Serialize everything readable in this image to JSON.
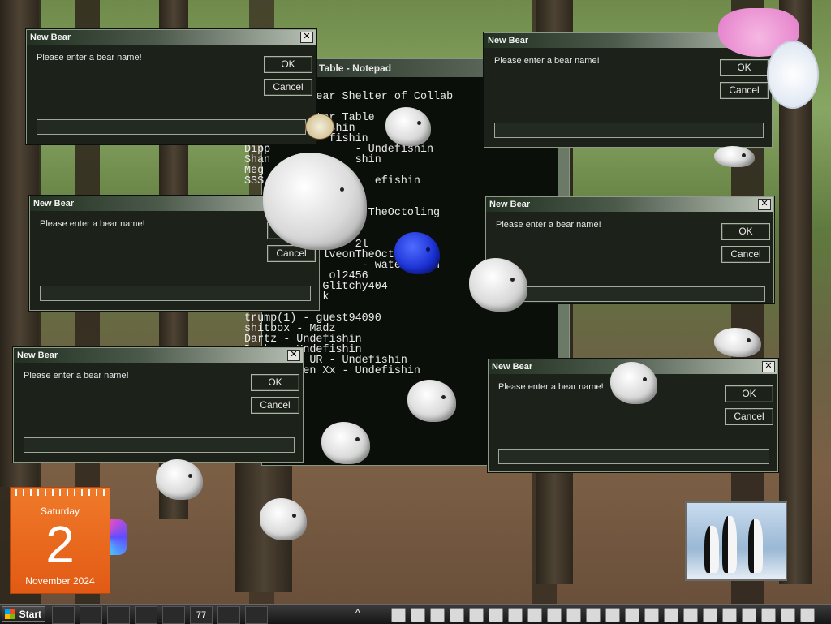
{
  "dialogs": [
    {
      "title": "New Bear",
      "message": "Please enter a bear name!",
      "ok": "OK",
      "cancel": "Cancel"
    },
    {
      "title": "New Bear",
      "message": "Please enter a bear name!",
      "ok": "OK",
      "cancel": "Cancel"
    },
    {
      "title": "New Bear",
      "message": "Please enter a bear name!",
      "ok": "OK",
      "cancel": "Cancel"
    },
    {
      "title": "New Bear",
      "message": "Please enter a bear name!",
      "ok": "OK",
      "cancel": "Cancel"
    },
    {
      "title": "New Bear",
      "message": "Please enter a bear name!",
      "ok": "OK",
      "cancel": "Cancel"
    },
    {
      "title": "New Bear",
      "message": "Please enter a bear name!",
      "ok": "OK",
      "cancel": "Cancel"
    }
  ],
  "close_glyph": "✕",
  "notepad": {
    "title": "Table - Notepad",
    "lines": [
      "      the Bear Shelter of Collab",
      "",
      "          lter Table",
      "             shin",
      "             fishin",
      "Dipp             - Undefishin",
      "Shan             shin",
      "Meg",
      "SSS                 efishin",
      "",
      "",
      "                   TheOctoling",
      "",
      "",
      "                 2l",
      "            lveonTheOct",
      "                  - watermelon",
      "             ol2456",
      "            Glitchy404",
      "            k",
      "",
      "trump(1) - guest94090",
      "shitbox - Madz",
      "Dartz - Undefishin",
      "Drake - Undefishin",
      "          UR - Undefishin",
      "        den Xx - Undefishin"
    ]
  },
  "calendar": {
    "weekday": "Saturday",
    "day": "2",
    "month_year": "November 2024"
  },
  "taskbar": {
    "start_label": "Start",
    "clock_badge": "77",
    "up_arrow": "^"
  }
}
